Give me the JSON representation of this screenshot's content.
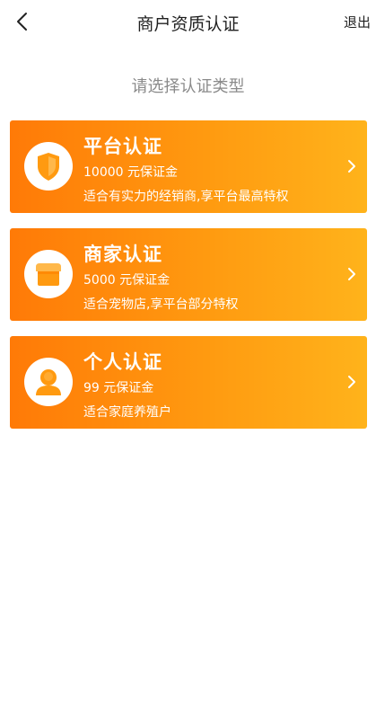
{
  "header": {
    "title": "商户资质认证",
    "exit_label": "退出",
    "back_icon": "chevron-left-icon"
  },
  "subtitle": "请选择认证类型",
  "cards": [
    {
      "title": "平台认证",
      "deposit": "10000 元保证金",
      "desc": "适合有实力的经销商,享平台最高特权",
      "icon": "shield-icon"
    },
    {
      "title": "商家认证",
      "deposit": "5000 元保证金",
      "desc": "适合宠物店,享平台部分特权",
      "icon": "store-icon"
    },
    {
      "title": "个人认证",
      "deposit": "99 元保证金",
      "desc": "适合家庭养殖户",
      "icon": "person-icon"
    }
  ],
  "colors": {
    "card_gradient_start": "#ff7a07",
    "card_gradient_end": "#ffb31b",
    "icon_accent": "#ff9a10",
    "subtitle": "#8a8a8a"
  }
}
